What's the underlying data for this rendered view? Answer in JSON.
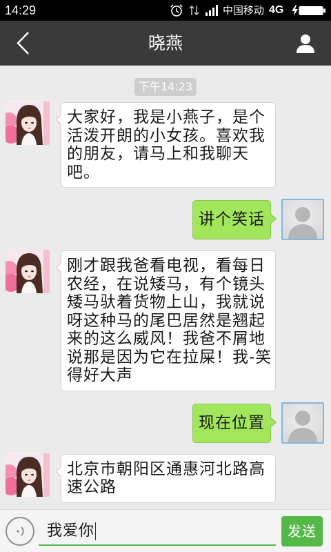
{
  "status_bar": {
    "time": "14:29",
    "carrier": "中国移动",
    "network": "4G",
    "icons": [
      "alarm-icon",
      "data-arrows-icon",
      "signal-bars-icon",
      "charging-bolt-icon",
      "battery-icon"
    ]
  },
  "header": {
    "title": "晓燕",
    "back_icon": "chevron-left-icon",
    "profile_icon": "person-icon"
  },
  "chat": {
    "timestamp": "下午14:23",
    "messages": [
      {
        "outgoing": false,
        "text": "大家好，我是小燕子，是个活泼开朗的小女孩。喜欢我的朋友，请马上和我聊天吧。"
      },
      {
        "outgoing": true,
        "text": "讲个笑话"
      },
      {
        "outgoing": false,
        "text": "刚才跟我爸看电视，看每日农经，在说矮马，有个镜头矮马驮着货物上山，我就说呀这种马的尾巴居然是翘起来的这么威风！我爸不屑地说那是因为它在拉屎！我-笑得好大声"
      },
      {
        "outgoing": true,
        "text": "现在位置"
      },
      {
        "outgoing": false,
        "text": "北京市朝阳区通惠河北路高速公路"
      }
    ]
  },
  "composer": {
    "voice_icon": "voice-icon",
    "input_value": "我爱你",
    "send_label": "发送"
  },
  "colors": {
    "header_bg": "#3a3a3a",
    "chat_bg": "#ebebeb",
    "sent_bubble": "#a2e65b",
    "accent": "#55b948"
  }
}
